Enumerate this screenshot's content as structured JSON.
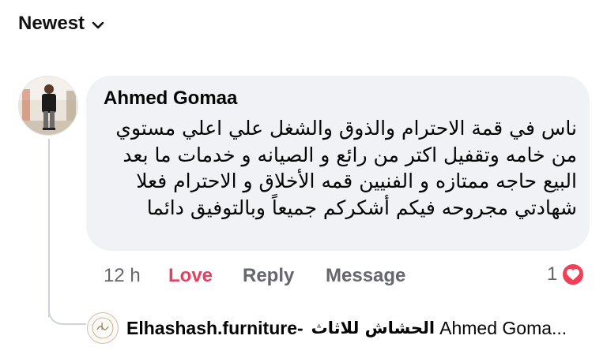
{
  "sort": {
    "label": "Newest",
    "icon": "chevron-down-icon"
  },
  "comment": {
    "author": "Ahmed Gomaa",
    "text_lines": [
      "ناس في قمة الاحترام والذوق والشغل علي اعلي مستوي",
      "من خامه وتقفيل اكتر من رائع و الصيانه و خدمات ما بعد",
      "البيع حاجه ممتازه و الفنيين قمه الأخلاق و الاحترام فعلا",
      "شهادتي مجروحه فيكم أشكركم جميعاً وبالتوفيق دائما"
    ],
    "time": "12 h",
    "actions": {
      "love": "Love",
      "reply": "Reply",
      "message": "Message"
    },
    "reaction_count": "1",
    "reaction_icon": "heart-icon",
    "colors": {
      "bubble": "#f0f2f5",
      "love": "#e4405f",
      "heart": "#f33e58"
    }
  },
  "reply": {
    "author": "Elhashash.furniture-",
    "author_arabic": "الحشاش للاثاث",
    "preview": "Ahmed Goma..."
  }
}
